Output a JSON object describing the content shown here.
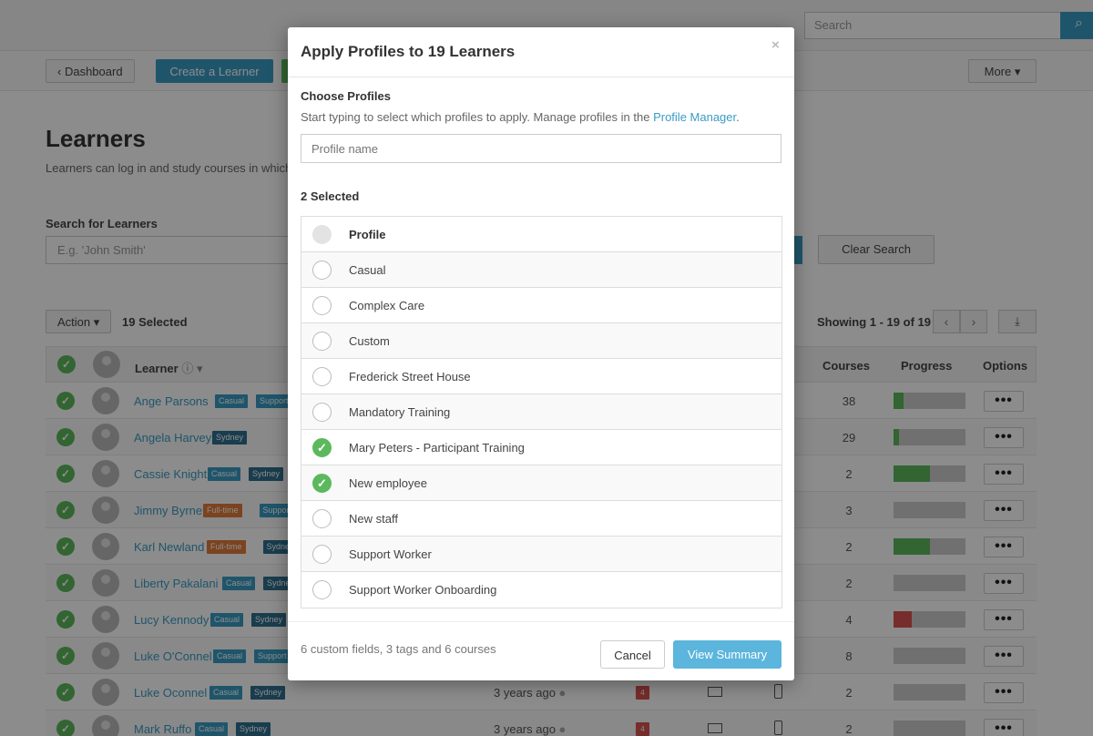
{
  "topbar": {
    "search_placeholder": "Search"
  },
  "subbar": {
    "dashboard_label": "Dashboard",
    "create_learner_label": "Create a Learner",
    "more_label": "More"
  },
  "page": {
    "title": "Learners",
    "description": "Learners can log in and study courses in which"
  },
  "search": {
    "label": "Search for Learners",
    "placeholder": "E.g. 'John Smith'",
    "clear_label": "Clear Search"
  },
  "toolbar": {
    "action_label": "Action",
    "selected_count": "19 Selected",
    "showing": "Showing 1 - 19 of 19"
  },
  "table": {
    "headers": {
      "learner": "Learner",
      "courses": "Courses",
      "progress": "Progress",
      "options": "Options"
    },
    "rows": [
      {
        "name": "Ange Parsons",
        "tags": [
          "Casual",
          "Support"
        ],
        "last_login": "",
        "msgs": "",
        "courses": "38",
        "progress": 0.14,
        "progress_color": "#5cb85c"
      },
      {
        "name": "Angela Harvey",
        "tags": [
          "Sydney"
        ],
        "last_login": "",
        "msgs": "",
        "courses": "29",
        "progress": 0.08,
        "progress_color": "#5cb85c"
      },
      {
        "name": "Cassie Knight",
        "tags": [
          "Casual",
          "Sydney"
        ],
        "last_login": "",
        "msgs": "",
        "courses": "2",
        "progress": 0.5,
        "progress_color": "#5cb85c"
      },
      {
        "name": "Jimmy Byrne",
        "tags": [
          "Full-time",
          "Support"
        ],
        "last_login": "",
        "msgs": "",
        "courses": "3",
        "progress": 0,
        "progress_color": "#5cb85c"
      },
      {
        "name": "Karl Newland",
        "tags": [
          "Full-time",
          "Sydney"
        ],
        "last_login": "",
        "msgs": "",
        "courses": "2",
        "progress": 0.5,
        "progress_color": "#5cb85c"
      },
      {
        "name": "Liberty Pakalani",
        "tags": [
          "Casual",
          "Sydney"
        ],
        "last_login": "",
        "msgs": "",
        "courses": "2",
        "progress": 0,
        "progress_color": "#5cb85c"
      },
      {
        "name": "Lucy Kennody",
        "tags": [
          "Casual",
          "Sydney"
        ],
        "last_login": "",
        "msgs": "",
        "courses": "4",
        "progress": 0.25,
        "progress_color": "#d9534f"
      },
      {
        "name": "Luke O'Connel",
        "tags": [
          "Casual",
          "Support"
        ],
        "last_login": "",
        "msgs": "",
        "courses": "8",
        "progress": 0,
        "progress_color": "#5cb85c"
      },
      {
        "name": "Luke Oconnel",
        "tags": [
          "Casual",
          "Sydney"
        ],
        "last_login": "3 years ago",
        "msgs": "4",
        "courses": "2",
        "progress": 0,
        "progress_color": "#5cb85c"
      },
      {
        "name": "Mark Ruffo",
        "tags": [
          "Casual",
          "Sydney"
        ],
        "last_login": "3 years ago",
        "msgs": "4",
        "courses": "2",
        "progress": 0,
        "progress_color": "#5cb85c"
      }
    ]
  },
  "modal": {
    "title": "Apply Profiles to 19 Learners",
    "close": "×",
    "choose_label": "Choose Profiles",
    "help_text": "Start typing to select which profiles to apply. Manage profiles in the ",
    "help_link": "Profile Manager",
    "help_suffix": ".",
    "input_placeholder": "Profile name",
    "selected_label": "2 Selected",
    "list_header": "Profile",
    "profiles": [
      {
        "name": "Casual",
        "selected": false
      },
      {
        "name": "Complex Care",
        "selected": false
      },
      {
        "name": "Custom",
        "selected": false
      },
      {
        "name": "Frederick Street House",
        "selected": false
      },
      {
        "name": "Mandatory Training",
        "selected": false
      },
      {
        "name": "Mary Peters - Participant Training",
        "selected": true
      },
      {
        "name": "New employee",
        "selected": true
      },
      {
        "name": "New staff",
        "selected": false
      },
      {
        "name": "Support Worker",
        "selected": false
      },
      {
        "name": "Support Worker Onboarding",
        "selected": false
      }
    ],
    "summary": "6 custom fields, 3 tags and 6 courses",
    "cancel_label": "Cancel",
    "view_summary_label": "View Summary"
  },
  "colors": {
    "accent": "#3a9cc4",
    "success": "#5cb85c",
    "danger": "#d9534f"
  }
}
